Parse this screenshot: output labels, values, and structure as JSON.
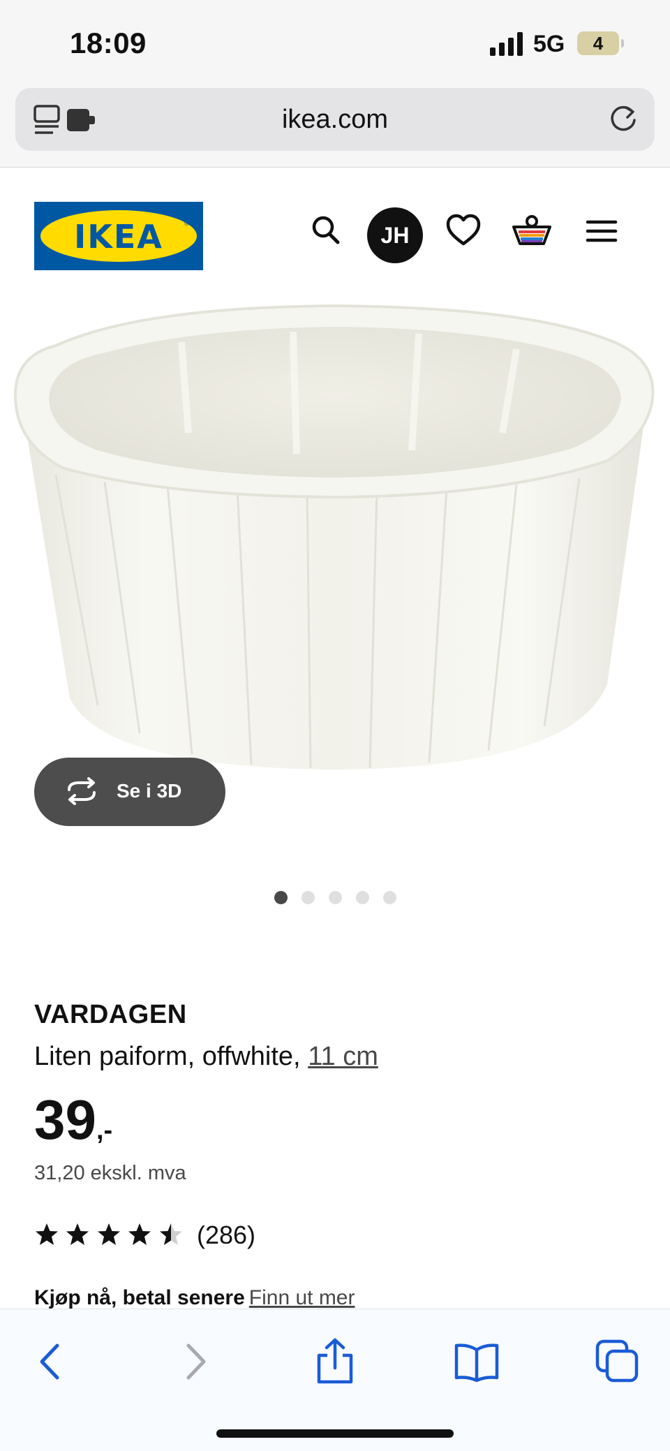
{
  "status_bar": {
    "time": "18:09",
    "network": "5G",
    "battery": "4"
  },
  "browser": {
    "url": "ikea.com"
  },
  "header": {
    "logo_text": "IKEA",
    "avatar_initials": "JH"
  },
  "product": {
    "view_3d_label": "Se i 3D",
    "image_count": 5,
    "active_image": 1,
    "name": "VARDAGEN",
    "description": "Liten paiform, offwhite,",
    "size": "11 cm",
    "price": "39",
    "price_suffix": ",-",
    "price_ex_vat": "31,20 ekskl. mva",
    "rating": 4.5,
    "review_count": "(286)"
  },
  "payment": {
    "text": "Kjøp nå, betal senere",
    "link": "Finn ut mer"
  },
  "colors": {
    "ikea_blue": "#0058a3",
    "ikea_yellow": "#ffdb00",
    "safari_blue": "#1a5bd6"
  }
}
